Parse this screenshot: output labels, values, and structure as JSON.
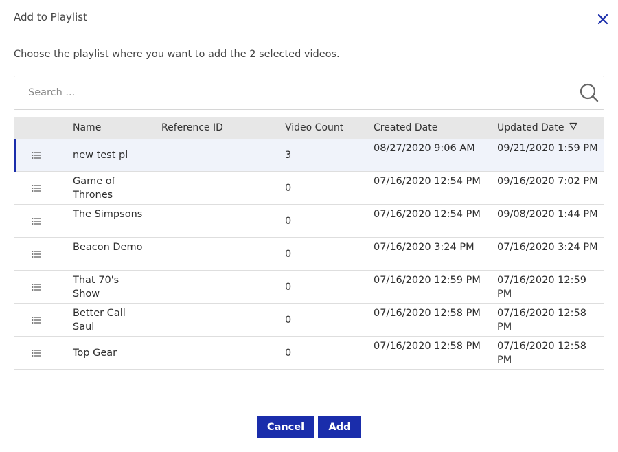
{
  "dialog": {
    "title": "Add to Playlist",
    "subtitle": "Choose the playlist where you want to add the 2 selected videos.",
    "close_icon": "close-icon"
  },
  "search": {
    "placeholder": "Search ...",
    "value": "",
    "icon": "search-icon"
  },
  "table": {
    "headers": {
      "name": "Name",
      "reference_id": "Reference ID",
      "video_count": "Video Count",
      "created_date": "Created Date",
      "updated_date": "Updated Date"
    },
    "sorted_column": "updated_date",
    "sort_direction": "descending",
    "rows": [
      {
        "name": "new test pl",
        "reference_id": "",
        "video_count": "3",
        "created_date": "08/27/2020 9:06 AM",
        "updated_date": "09/21/2020 1:59 PM",
        "selected": true
      },
      {
        "name": "Game of Thrones",
        "reference_id": "",
        "video_count": "0",
        "created_date": "07/16/2020 12:54 PM",
        "updated_date": "09/16/2020 7:02 PM",
        "selected": false
      },
      {
        "name": "The Simpsons",
        "reference_id": "",
        "video_count": "0",
        "created_date": "07/16/2020 12:54 PM",
        "updated_date": "09/08/2020 1:44 PM",
        "selected": false
      },
      {
        "name": "Beacon Demo",
        "reference_id": "",
        "video_count": "0",
        "created_date": "07/16/2020 3:24 PM",
        "updated_date": "07/16/2020 3:24 PM",
        "selected": false
      },
      {
        "name": "That 70's Show",
        "reference_id": "",
        "video_count": "0",
        "created_date": "07/16/2020 12:59 PM",
        "updated_date": "07/16/2020 12:59 PM",
        "selected": false
      },
      {
        "name": "Better Call Saul",
        "reference_id": "",
        "video_count": "0",
        "created_date": "07/16/2020 12:58 PM",
        "updated_date": "07/16/2020 12:58 PM",
        "selected": false
      },
      {
        "name": "Top Gear",
        "reference_id": "",
        "video_count": "0",
        "created_date": "07/16/2020 12:58 PM",
        "updated_date": "07/16/2020 12:58 PM",
        "selected": false
      }
    ]
  },
  "buttons": {
    "cancel_label": "Cancel",
    "add_label": "Add"
  },
  "colors": {
    "accent": "#1a2dab",
    "header_bg": "#e7e7e7",
    "selected_row_bg": "#f0f3fa"
  }
}
